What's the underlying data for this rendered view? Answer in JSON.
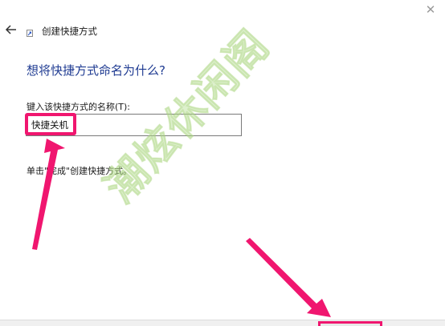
{
  "window": {
    "title": "创建快捷方式",
    "close_glyph": "✕"
  },
  "page": {
    "heading": "想将快捷方式命名为什么?",
    "field_label": "键入该快捷方式的名称(T):",
    "field_value": "快捷关机",
    "instruction": "单击\"完成\"创建快捷方式。"
  },
  "watermark": {
    "text": "潮炫休闲阁"
  },
  "annotations": {
    "accent_color": "#f0166f"
  },
  "icons": {
    "back": "back-arrow-icon",
    "shortcut": "shortcut-icon",
    "close": "close-icon"
  }
}
